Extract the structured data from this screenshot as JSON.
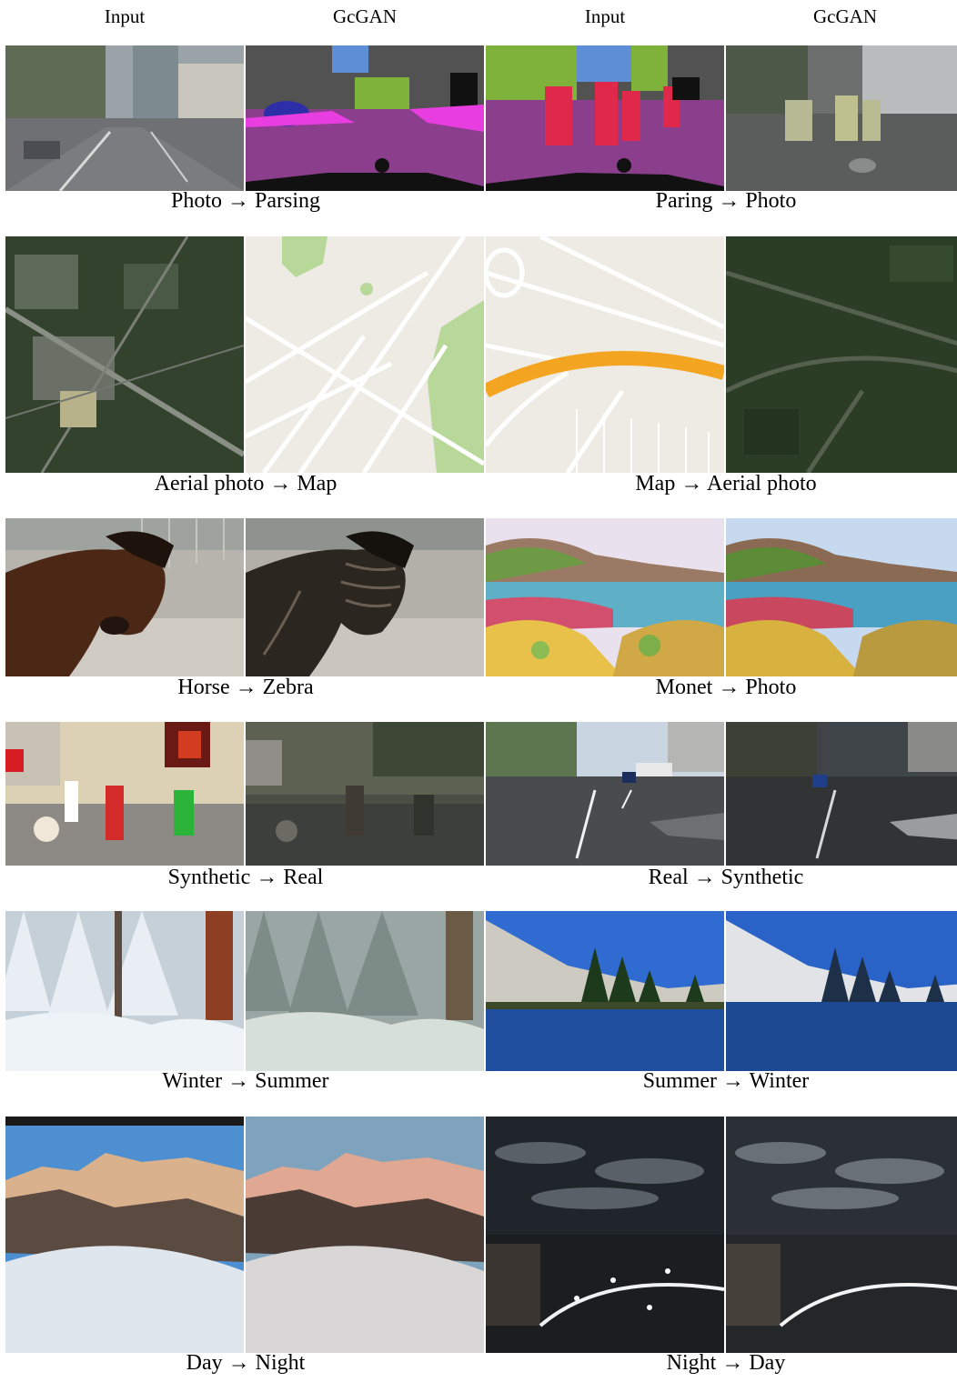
{
  "column_headers": [
    "Input",
    "GcGAN",
    "Input",
    "GcGAN"
  ],
  "captions": [
    {
      "left": "Photo → Parsing",
      "right": "Paring → Photo"
    },
    {
      "left": "Aerial photo → Map",
      "right": "Map → Aerial photo"
    },
    {
      "left": "Horse → Zebra",
      "right": "Monet → Photo"
    },
    {
      "left": "Synthetic → Real",
      "right": "Real → Synthetic"
    },
    {
      "left": "Winter → Summer",
      "right": "Summer → Winter"
    },
    {
      "left": "Day → Night",
      "right": "Night → Day"
    }
  ],
  "colors": {
    "parsing_road": "#8a3e8c",
    "parsing_sidewalk": "#e83de0",
    "parsing_person": "#e0284a",
    "parsing_vegetation": "#7fb23a",
    "parsing_building": "#525252",
    "map_background": "#eeebe4",
    "map_green": "#b8d89a",
    "map_highway": "#f3a522",
    "aerial_green": "#2b3e25",
    "snow": "#e6edf4",
    "sky_blue": "#2f6bd0",
    "water_blue": "#1f4f9e"
  }
}
